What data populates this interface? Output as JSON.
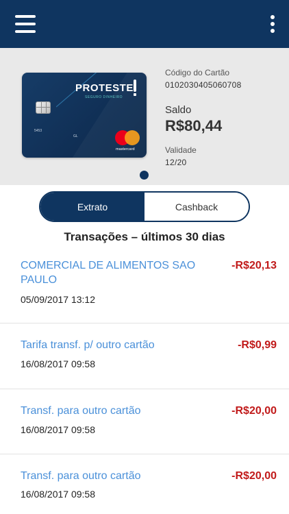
{
  "card": {
    "brand": "PROTESTE",
    "brand_sub": "SEGURO DINHEIRO",
    "number_prefix": "5453",
    "network_label": "mastercard",
    "code_label": "Código do Cartão",
    "code_value": "0102030405060708",
    "balance_label": "Saldo",
    "balance_value": "R$80,44",
    "validity_label": "Validade",
    "validity_value": "12/20"
  },
  "tabs": [
    {
      "label": "Extrato",
      "active": true
    },
    {
      "label": "Cashback",
      "active": false
    }
  ],
  "section_title": "Transações – últimos 30 dias",
  "transactions": [
    {
      "description": "COMERCIAL DE ALIMENTOS SAO PAULO",
      "date": "05/09/2017 13:12",
      "amount": "-R$20,13"
    },
    {
      "description": "Tarifa transf. p/ outro cartão",
      "date": "16/08/2017 09:58",
      "amount": "-R$0,99"
    },
    {
      "description": "Transf. para outro cartão",
      "date": "16/08/2017 09:58",
      "amount": "-R$20,00"
    },
    {
      "description": "Transf. para outro cartão",
      "date": "16/08/2017 09:58",
      "amount": "-R$20,00"
    }
  ],
  "colors": {
    "primary": "#0f3560",
    "link": "#4a90d9",
    "negative": "#c11a1a"
  }
}
